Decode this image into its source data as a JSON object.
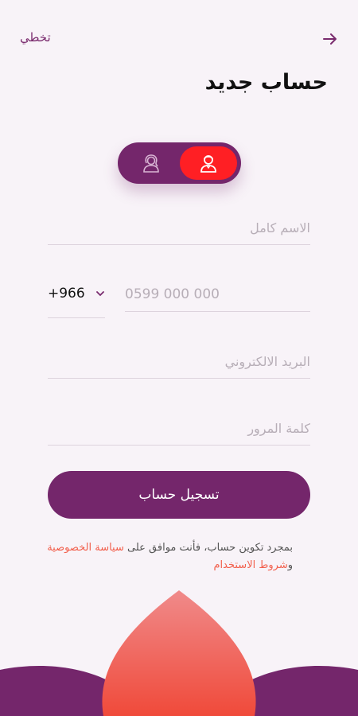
{
  "header": {
    "skip_label": "تخطي",
    "title": "حساب جديد"
  },
  "account_type": {
    "options": [
      {
        "icon": "user-male-icon",
        "selected": true
      },
      {
        "icon": "user-female-icon",
        "selected": false
      }
    ],
    "colors": {
      "track": "#74266b",
      "active": "#ff1f24"
    }
  },
  "form": {
    "full_name": {
      "placeholder": "الاسم كامل",
      "value": ""
    },
    "phone": {
      "country_code": "+966",
      "placeholder": "0599 000 000",
      "value": ""
    },
    "email": {
      "placeholder": "البريد الالكتروني",
      "value": ""
    },
    "password": {
      "placeholder": "كلمة المرور",
      "value": ""
    },
    "submit_label": "تسجيل حساب"
  },
  "terms": {
    "prefix": "بمجرد تكوين حساب، فأنت موافق على ",
    "privacy_link": "سياسة الخصوصية",
    "conjunction": " و",
    "terms_link": "شروط الاستخدام"
  },
  "colors": {
    "primary": "#74266b",
    "accent": "#f2604d",
    "background": "#f8f3f8"
  }
}
